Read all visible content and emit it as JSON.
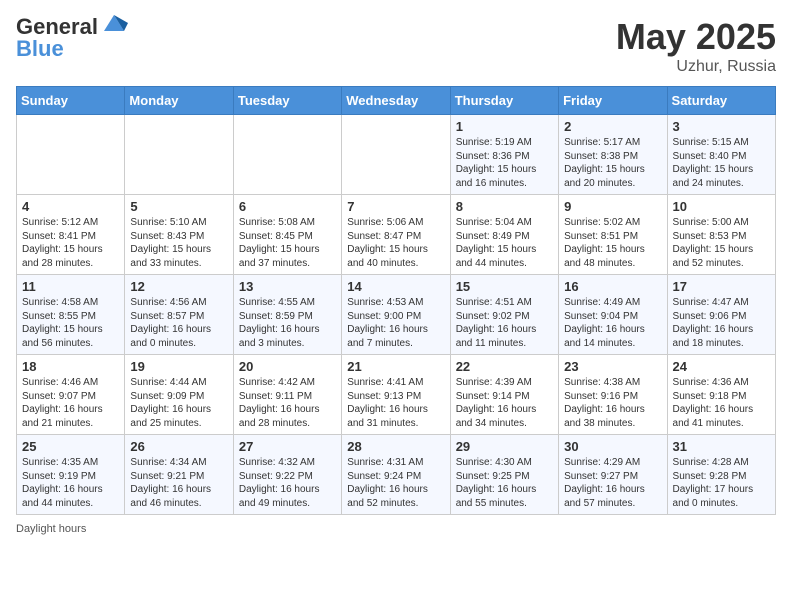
{
  "header": {
    "logo_general": "General",
    "logo_blue": "Blue",
    "month_year": "May 2025",
    "location": "Uzhur, Russia"
  },
  "weekdays": [
    "Sunday",
    "Monday",
    "Tuesday",
    "Wednesday",
    "Thursday",
    "Friday",
    "Saturday"
  ],
  "weeks": [
    [
      {
        "day": "",
        "info": ""
      },
      {
        "day": "",
        "info": ""
      },
      {
        "day": "",
        "info": ""
      },
      {
        "day": "",
        "info": ""
      },
      {
        "day": "1",
        "info": "Sunrise: 5:19 AM\nSunset: 8:36 PM\nDaylight: 15 hours\nand 16 minutes."
      },
      {
        "day": "2",
        "info": "Sunrise: 5:17 AM\nSunset: 8:38 PM\nDaylight: 15 hours\nand 20 minutes."
      },
      {
        "day": "3",
        "info": "Sunrise: 5:15 AM\nSunset: 8:40 PM\nDaylight: 15 hours\nand 24 minutes."
      }
    ],
    [
      {
        "day": "4",
        "info": "Sunrise: 5:12 AM\nSunset: 8:41 PM\nDaylight: 15 hours\nand 28 minutes."
      },
      {
        "day": "5",
        "info": "Sunrise: 5:10 AM\nSunset: 8:43 PM\nDaylight: 15 hours\nand 33 minutes."
      },
      {
        "day": "6",
        "info": "Sunrise: 5:08 AM\nSunset: 8:45 PM\nDaylight: 15 hours\nand 37 minutes."
      },
      {
        "day": "7",
        "info": "Sunrise: 5:06 AM\nSunset: 8:47 PM\nDaylight: 15 hours\nand 40 minutes."
      },
      {
        "day": "8",
        "info": "Sunrise: 5:04 AM\nSunset: 8:49 PM\nDaylight: 15 hours\nand 44 minutes."
      },
      {
        "day": "9",
        "info": "Sunrise: 5:02 AM\nSunset: 8:51 PM\nDaylight: 15 hours\nand 48 minutes."
      },
      {
        "day": "10",
        "info": "Sunrise: 5:00 AM\nSunset: 8:53 PM\nDaylight: 15 hours\nand 52 minutes."
      }
    ],
    [
      {
        "day": "11",
        "info": "Sunrise: 4:58 AM\nSunset: 8:55 PM\nDaylight: 15 hours\nand 56 minutes."
      },
      {
        "day": "12",
        "info": "Sunrise: 4:56 AM\nSunset: 8:57 PM\nDaylight: 16 hours\nand 0 minutes."
      },
      {
        "day": "13",
        "info": "Sunrise: 4:55 AM\nSunset: 8:59 PM\nDaylight: 16 hours\nand 3 minutes."
      },
      {
        "day": "14",
        "info": "Sunrise: 4:53 AM\nSunset: 9:00 PM\nDaylight: 16 hours\nand 7 minutes."
      },
      {
        "day": "15",
        "info": "Sunrise: 4:51 AM\nSunset: 9:02 PM\nDaylight: 16 hours\nand 11 minutes."
      },
      {
        "day": "16",
        "info": "Sunrise: 4:49 AM\nSunset: 9:04 PM\nDaylight: 16 hours\nand 14 minutes."
      },
      {
        "day": "17",
        "info": "Sunrise: 4:47 AM\nSunset: 9:06 PM\nDaylight: 16 hours\nand 18 minutes."
      }
    ],
    [
      {
        "day": "18",
        "info": "Sunrise: 4:46 AM\nSunset: 9:07 PM\nDaylight: 16 hours\nand 21 minutes."
      },
      {
        "day": "19",
        "info": "Sunrise: 4:44 AM\nSunset: 9:09 PM\nDaylight: 16 hours\nand 25 minutes."
      },
      {
        "day": "20",
        "info": "Sunrise: 4:42 AM\nSunset: 9:11 PM\nDaylight: 16 hours\nand 28 minutes."
      },
      {
        "day": "21",
        "info": "Sunrise: 4:41 AM\nSunset: 9:13 PM\nDaylight: 16 hours\nand 31 minutes."
      },
      {
        "day": "22",
        "info": "Sunrise: 4:39 AM\nSunset: 9:14 PM\nDaylight: 16 hours\nand 34 minutes."
      },
      {
        "day": "23",
        "info": "Sunrise: 4:38 AM\nSunset: 9:16 PM\nDaylight: 16 hours\nand 38 minutes."
      },
      {
        "day": "24",
        "info": "Sunrise: 4:36 AM\nSunset: 9:18 PM\nDaylight: 16 hours\nand 41 minutes."
      }
    ],
    [
      {
        "day": "25",
        "info": "Sunrise: 4:35 AM\nSunset: 9:19 PM\nDaylight: 16 hours\nand 44 minutes."
      },
      {
        "day": "26",
        "info": "Sunrise: 4:34 AM\nSunset: 9:21 PM\nDaylight: 16 hours\nand 46 minutes."
      },
      {
        "day": "27",
        "info": "Sunrise: 4:32 AM\nSunset: 9:22 PM\nDaylight: 16 hours\nand 49 minutes."
      },
      {
        "day": "28",
        "info": "Sunrise: 4:31 AM\nSunset: 9:24 PM\nDaylight: 16 hours\nand 52 minutes."
      },
      {
        "day": "29",
        "info": "Sunrise: 4:30 AM\nSunset: 9:25 PM\nDaylight: 16 hours\nand 55 minutes."
      },
      {
        "day": "30",
        "info": "Sunrise: 4:29 AM\nSunset: 9:27 PM\nDaylight: 16 hours\nand 57 minutes."
      },
      {
        "day": "31",
        "info": "Sunrise: 4:28 AM\nSunset: 9:28 PM\nDaylight: 17 hours\nand 0 minutes."
      }
    ]
  ],
  "footer": {
    "daylight_hours": "Daylight hours"
  }
}
